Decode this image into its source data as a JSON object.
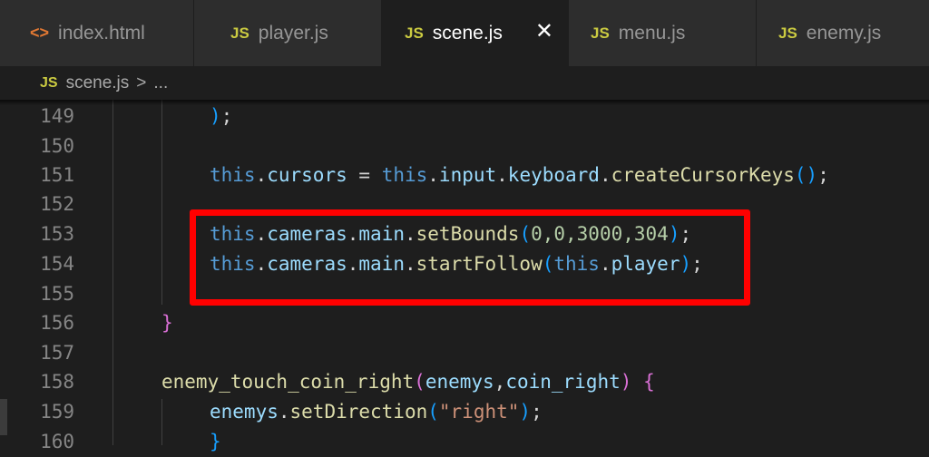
{
  "tabs": [
    {
      "icon": "<>",
      "label": "index.html",
      "active": false
    },
    {
      "icon": "JS",
      "label": "player.js",
      "active": false
    },
    {
      "icon": "JS",
      "label": "scene.js",
      "active": true,
      "close": "✕"
    },
    {
      "icon": "JS",
      "label": "menu.js",
      "active": false
    },
    {
      "icon": "JS",
      "label": "enemy.js",
      "active": false
    }
  ],
  "breadcrumb": {
    "icon": "JS",
    "file": "scene.js",
    "sep": ">",
    "more": "..."
  },
  "lines": [
    {
      "num": "149"
    },
    {
      "num": "150"
    },
    {
      "num": "151"
    },
    {
      "num": "152"
    },
    {
      "num": "153"
    },
    {
      "num": "154"
    },
    {
      "num": "155"
    },
    {
      "num": "156"
    },
    {
      "num": "157"
    },
    {
      "num": "158"
    },
    {
      "num": "159"
    },
    {
      "num": "160"
    }
  ],
  "code": {
    "l149": {
      "paren": ")",
      "semi": ";"
    },
    "l151": {
      "this1": "this",
      "dot1": ".",
      "cursors": "cursors",
      "eq": " = ",
      "this2": "this",
      "dot2": ".",
      "input": "input",
      "dot3": ".",
      "keyboard": "keyboard",
      "dot4": ".",
      "fn": "createCursorKeys",
      "parens": "()",
      "semi": ";"
    },
    "l153": {
      "this": "this",
      "d1": ".",
      "cameras": "cameras",
      "d2": ".",
      "main": "main",
      "d3": ".",
      "fn": "setBounds",
      "open": "(",
      "args": "0,0,3000,304",
      "close": ")",
      "semi": ";"
    },
    "l154": {
      "this": "this",
      "d1": ".",
      "cameras": "cameras",
      "d2": ".",
      "main": "main",
      "d3": ".",
      "fn": "startFollow",
      "open": "(",
      "this2": "this",
      "d4": ".",
      "player": "player",
      "close": ")",
      "semi": ";"
    },
    "l156": {
      "brace": "}"
    },
    "l158": {
      "fn": "enemy_touch_coin_right",
      "open": "(",
      "p1": "enemys",
      "comma": ",",
      "p2": "coin_right",
      "close": ")",
      "space": " ",
      "brace": "{"
    },
    "l159": {
      "obj": "enemys",
      "d1": ".",
      "fn": "setDirection",
      "open": "(",
      "str": "\"right\"",
      "close": ")",
      "semi": ";"
    },
    "l160": {
      "brace": "}"
    }
  },
  "colors": {
    "highlight": "#ff0000",
    "keyword": "#569cd6",
    "property": "#9cdcfe",
    "function": "#dcdcaa"
  }
}
